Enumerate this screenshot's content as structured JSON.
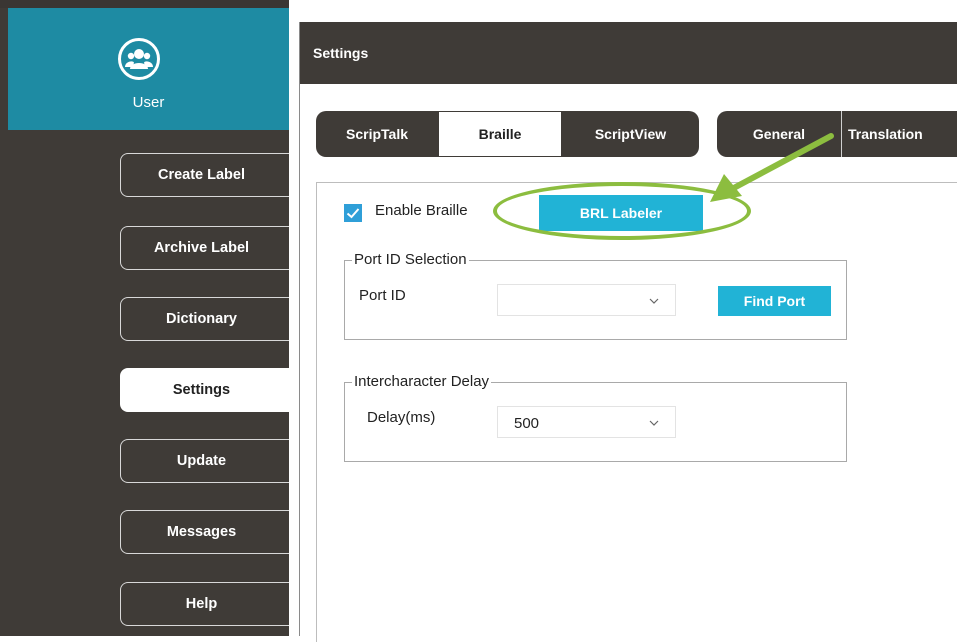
{
  "user": {
    "label": "User"
  },
  "sidebar": {
    "items": [
      {
        "label": "Create Label"
      },
      {
        "label": "Archive Label"
      },
      {
        "label": "Dictionary"
      },
      {
        "label": "Settings"
      },
      {
        "label": "Update"
      },
      {
        "label": "Messages"
      },
      {
        "label": "Help"
      }
    ],
    "active": "Settings"
  },
  "header": {
    "title": "Settings"
  },
  "tabs": {
    "group1": [
      {
        "label": "ScripTalk"
      },
      {
        "label": "Braille"
      },
      {
        "label": "ScriptView"
      }
    ],
    "group2": [
      {
        "label": "General"
      },
      {
        "label": "Translation"
      }
    ],
    "active": "Braille"
  },
  "braille": {
    "enable_label": "Enable Braille",
    "enable_checked": true,
    "labeler_button": "BRL Labeler",
    "port_group": {
      "title": "Port ID Selection",
      "field_label": "Port ID",
      "value": "",
      "find_button": "Find Port"
    },
    "delay_group": {
      "title": "Intercharacter Delay",
      "field_label": "Delay(ms)",
      "value": "500"
    }
  },
  "annotation": {
    "ellipse_color": "#8cbd3f",
    "arrow_color": "#8cbd3f"
  },
  "colors": {
    "sidebar_bg": "#3f3b37",
    "user_panel_bg": "#1e8ba3",
    "button_accent": "#21b3d6",
    "checkbox": "#2f9fd8"
  }
}
